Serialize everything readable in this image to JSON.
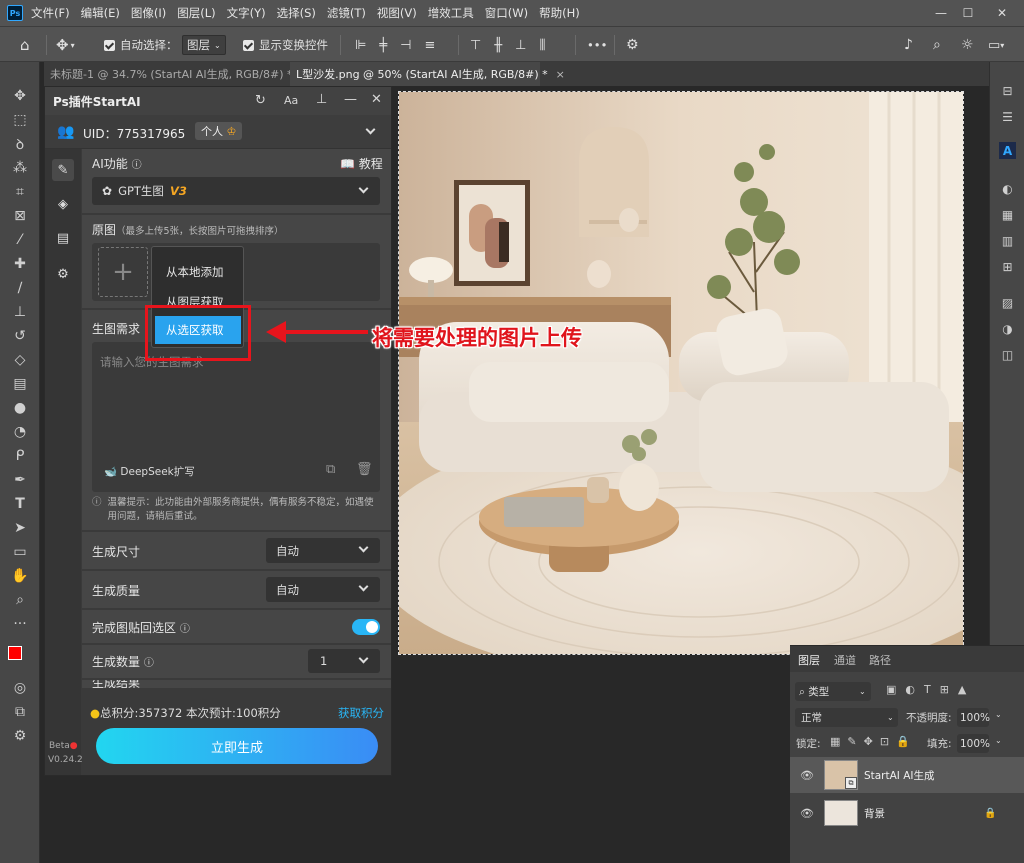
{
  "app": {
    "logo": "Ps"
  },
  "menu": [
    "文件(F)",
    "编辑(E)",
    "图像(I)",
    "图层(L)",
    "文字(Y)",
    "选择(S)",
    "滤镜(T)",
    "视图(V)",
    "增效工具",
    "窗口(W)",
    "帮助(H)"
  ],
  "options": {
    "auto_select_label": "自动选择：",
    "auto_select_value": "图层",
    "show_transform": "显示变换控件",
    "more": "•••"
  },
  "tabs": [
    {
      "label": "未标题-1 @ 34.7% (StartAI AI生成, RGB/8#) *",
      "close": "×"
    },
    {
      "label": "L型沙发.png @ 50% (StartAI AI生成, RGB/8#) *",
      "close": "×"
    }
  ],
  "plugin": {
    "title": "Ps插件StartAI",
    "uid": "UID：775317965",
    "badge": "个人",
    "ai_func": "AI功能",
    "tutorial": "教程",
    "model": "GPT生图",
    "model_version": "V3",
    "source_label": "原图",
    "source_hint": "（最多上传5张，长按图片可拖拽排序）",
    "add_plus": "+",
    "menu_local": "从本地添加",
    "menu_layer": "从图层获取",
    "menu_selection": "从选区获取",
    "prompt_label": "生图需求",
    "prompt_placeholder": "请输入您的生图需求",
    "deepseek": "DeepSeek扩写",
    "notice": "温馨提示：此功能由外部服务商提供，偶有服务不稳定，如遇使用问题，请稍后重试。",
    "size_label": "生成尺寸",
    "size_value": "自动",
    "quality_label": "生成质量",
    "quality_value": "自动",
    "paste_label": "完成图贴回选区",
    "count_label": "生成数量",
    "count_value": "1",
    "cut_label": "生成结果",
    "points": "总积分:357372  本次预计:100积分",
    "get_points": "获取积分",
    "generate": "立即生成",
    "beta": "Beta",
    "version": "V0.24.2"
  },
  "annotation": "将需要处理的图片上传",
  "layers": {
    "tabs": [
      "图层",
      "通道",
      "路径"
    ],
    "filter": "类型",
    "blend": "正常",
    "opacity_label": "不透明度:",
    "opacity": "100%",
    "lock_label": "锁定:",
    "fill_label": "填充:",
    "fill": "100%",
    "items": [
      {
        "name": "StartAI AI生成"
      },
      {
        "name": "背景"
      }
    ]
  },
  "colors": {
    "foreground": "#ff0000",
    "background": "#ffffff",
    "accent": "#31a8ff",
    "annotation": "#e8141c"
  }
}
